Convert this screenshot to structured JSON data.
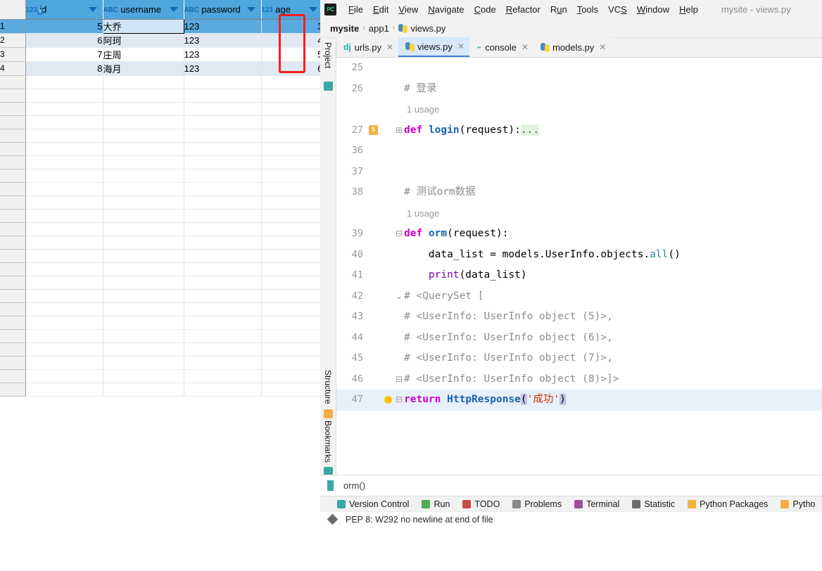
{
  "datagrid": {
    "columns": [
      {
        "name": "id",
        "type_icon": "123",
        "icon_kind": "number-key",
        "has_filter": true
      },
      {
        "name": "username",
        "type_icon": "ABC",
        "icon_kind": "text",
        "has_filter": true
      },
      {
        "name": "password",
        "type_icon": "ABC",
        "icon_kind": "text",
        "has_filter": true
      },
      {
        "name": "age",
        "type_icon": "123",
        "icon_kind": "number",
        "has_filter": true
      }
    ],
    "rows": [
      {
        "num": "1",
        "id": "5",
        "username": "大乔",
        "password": "123",
        "age": "3"
      },
      {
        "num": "2",
        "id": "6",
        "username": "阿珂",
        "password": "123",
        "age": "4"
      },
      {
        "num": "3",
        "id": "7",
        "username": "庄周",
        "password": "123",
        "age": "5"
      },
      {
        "num": "4",
        "id": "8",
        "username": "海月",
        "password": "123",
        "age": "6"
      }
    ],
    "selected_row": 1,
    "focused_cell": "大乔",
    "empty_row_count": 24,
    "annotation_color": "#fb1c1c"
  },
  "ide": {
    "logo": "PC",
    "window_title": "mysite - views.py",
    "menu": [
      {
        "label": "File",
        "mnemonic": "F"
      },
      {
        "label": "Edit",
        "mnemonic": "E"
      },
      {
        "label": "View",
        "mnemonic": "V"
      },
      {
        "label": "Navigate",
        "mnemonic": "N"
      },
      {
        "label": "Code",
        "mnemonic": "C"
      },
      {
        "label": "Refactor",
        "mnemonic": "R"
      },
      {
        "label": "Run",
        "mnemonic": "u"
      },
      {
        "label": "Tools",
        "mnemonic": "T"
      },
      {
        "label": "VCS",
        "mnemonic": "S"
      },
      {
        "label": "Window",
        "mnemonic": "W"
      },
      {
        "label": "Help",
        "mnemonic": "H"
      }
    ],
    "breadcrumb": [
      {
        "label": "mysite",
        "icon": "none",
        "bold": true
      },
      {
        "label": "app1",
        "icon": "none",
        "bold": false
      },
      {
        "label": "views.py",
        "icon": "python-icon",
        "bold": false
      }
    ],
    "tabs": [
      {
        "label": "urls.py",
        "icon": "django-icon",
        "active": false
      },
      {
        "label": "views.py",
        "icon": "python-icon",
        "active": true
      },
      {
        "label": "console",
        "icon": "console-icon",
        "active": false
      },
      {
        "label": "models.py",
        "icon": "python-icon",
        "active": false
      }
    ],
    "side_tools": [
      {
        "label": "Project",
        "icon": "project-icon",
        "position": "top"
      },
      {
        "label": "Structure",
        "icon": "structure-icon",
        "position": "bottom"
      },
      {
        "label": "Bookmarks",
        "icon": "bookmarks-icon",
        "position": "bottom"
      }
    ],
    "editor": {
      "lines": [
        {
          "no": "25",
          "kind": "blank",
          "text": ""
        },
        {
          "no": "26",
          "kind": "comment",
          "text": "# 登录"
        },
        {
          "no": "",
          "kind": "inlay",
          "text": "1 usage"
        },
        {
          "no": "27",
          "kind": "def_folded",
          "text": "def login(request):...",
          "gutter": "html-icon",
          "fold": "+"
        },
        {
          "no": "36",
          "kind": "blank",
          "text": ""
        },
        {
          "no": "37",
          "kind": "blank",
          "text": ""
        },
        {
          "no": "38",
          "kind": "comment",
          "text": "# 测试orm数据"
        },
        {
          "no": "",
          "kind": "inlay",
          "text": "1 usage"
        },
        {
          "no": "39",
          "kind": "def",
          "text": "def orm(request):",
          "fold": "-"
        },
        {
          "no": "40",
          "kind": "assign",
          "text": "data_list = models.UserInfo.objects.all()"
        },
        {
          "no": "41",
          "kind": "print",
          "text": "print(data_list)"
        },
        {
          "no": "42",
          "kind": "comment",
          "text": "# <QuerySet [",
          "fold": "v"
        },
        {
          "no": "43",
          "kind": "comment",
          "text": "# <UserInfo: UserInfo object (5)>,"
        },
        {
          "no": "44",
          "kind": "comment",
          "text": "# <UserInfo: UserInfo object (6)>,"
        },
        {
          "no": "45",
          "kind": "comment",
          "text": "# <UserInfo: UserInfo object (7)>,"
        },
        {
          "no": "46",
          "kind": "comment",
          "text": "# <UserInfo: UserInfo object (8)>]>",
          "fold": "-"
        },
        {
          "no": "47",
          "kind": "return",
          "text": "return HttpResponse('成功')",
          "highlighted": true,
          "gutter": "bulb-icon",
          "fold": "-"
        }
      ],
      "annotation_color": "#fb1c1c",
      "annotated_values": [
        "(5)",
        "(6)",
        "(7)",
        "(8)"
      ]
    },
    "bottom_breadcrumb": "orm()",
    "tool_windows": [
      {
        "label": "Version Control",
        "icon": "branch-icon",
        "color": "#3aa8a0"
      },
      {
        "label": "Run",
        "icon": "run-icon",
        "color": "#4caf50"
      },
      {
        "label": "TODO",
        "icon": "todo-icon",
        "color": "#c94a4a"
      },
      {
        "label": "Problems",
        "icon": "problems-icon",
        "color": "#8a8a8a"
      },
      {
        "label": "Terminal",
        "icon": "terminal-icon",
        "color": "#9c4f96"
      },
      {
        "label": "Statistic",
        "icon": "statistic-icon",
        "color": "#6b6b6b"
      },
      {
        "label": "Python Packages",
        "icon": "packages-icon",
        "color": "#f5b041"
      },
      {
        "label": "Pytho",
        "icon": "python-console-icon",
        "color": "#f5b041"
      }
    ],
    "status_message": "PEP 8: W292 no newline at end of file"
  }
}
